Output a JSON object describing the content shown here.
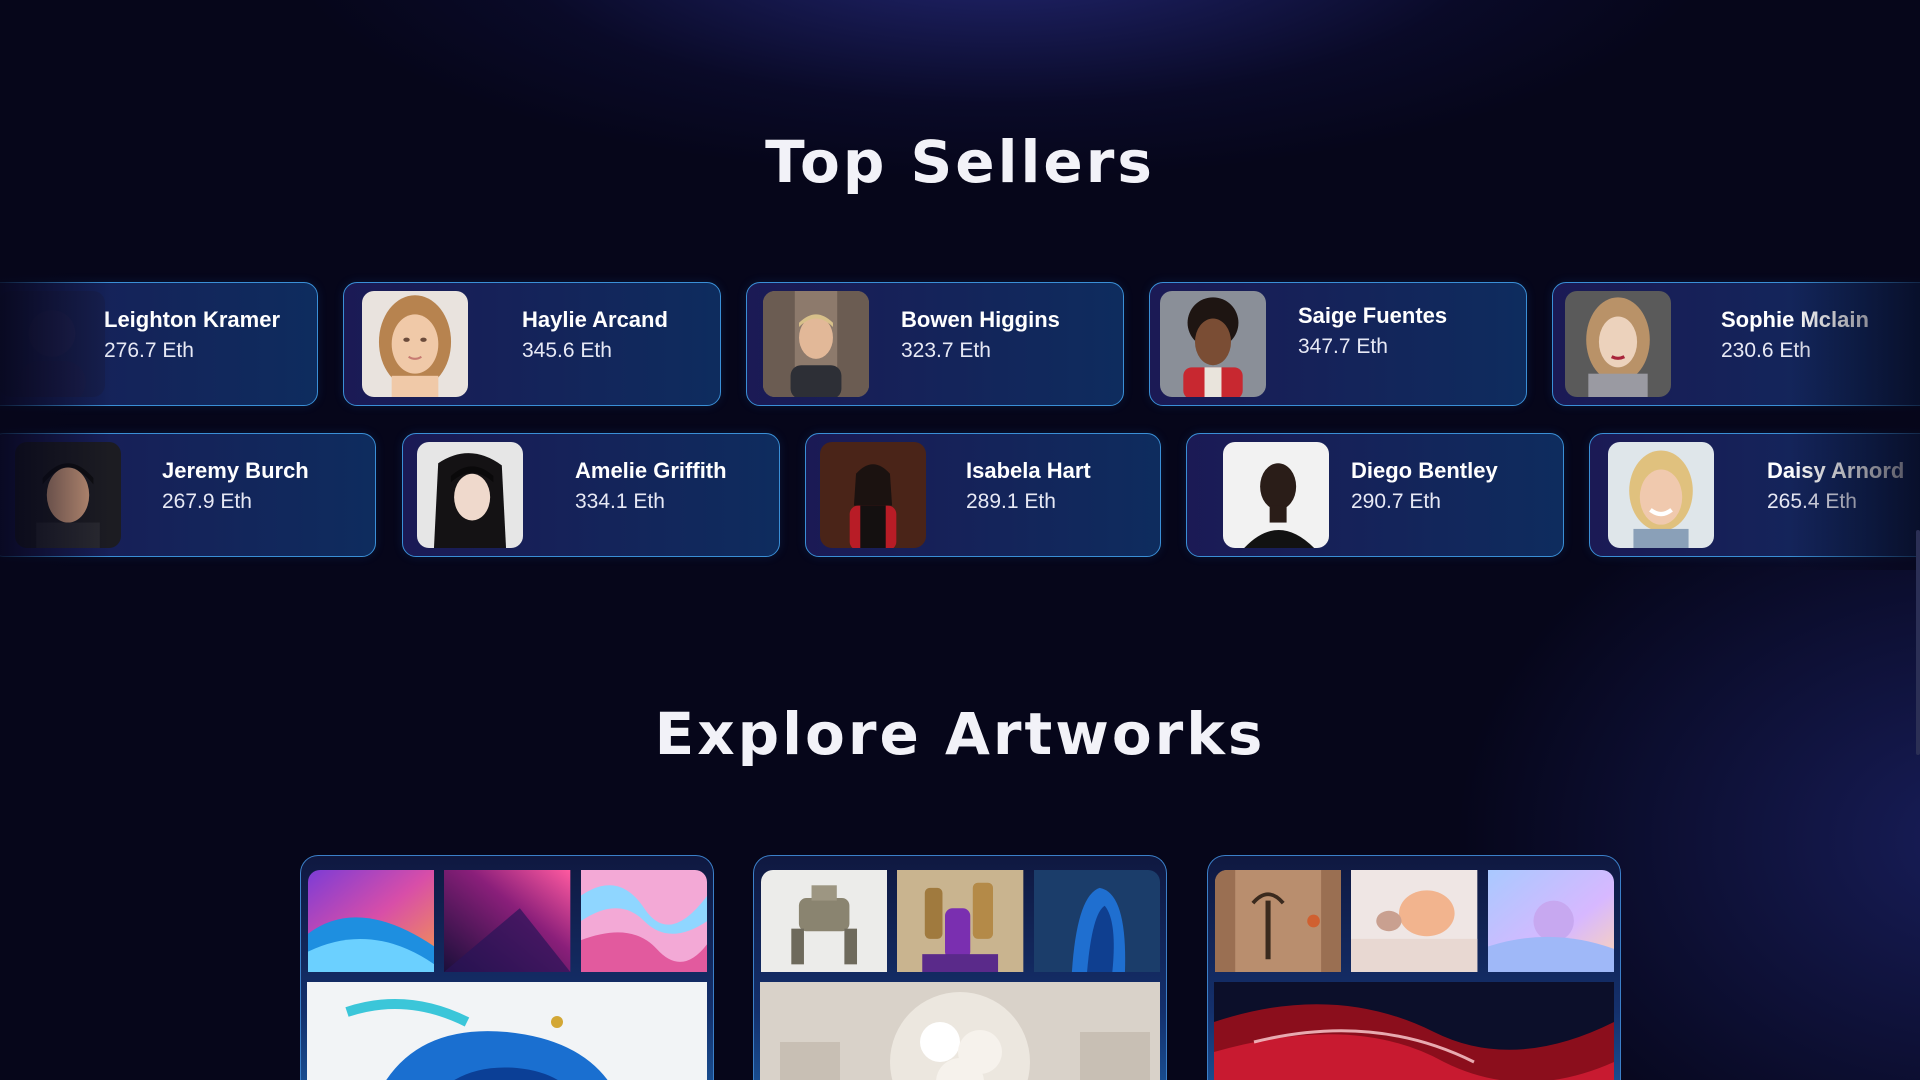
{
  "sections": {
    "top_sellers_title": "Top Sellers",
    "explore_title": "Explore Artworks"
  },
  "sellers_row_1": [
    {
      "name": "Leighton Kramer",
      "amount": "276.7 Eth",
      "avatar": "avatar-leighton"
    },
    {
      "name": "Haylie Arcand",
      "amount": "345.6 Eth",
      "avatar": "avatar-haylie"
    },
    {
      "name": "Bowen Higgins",
      "amount": "323.7 Eth",
      "avatar": "avatar-bowen"
    },
    {
      "name": "Saige Fuentes",
      "amount": "347.7 Eth",
      "avatar": "avatar-saige"
    },
    {
      "name": "Sophie Mclain",
      "amount": "230.6 Eth",
      "avatar": "avatar-sophie"
    }
  ],
  "sellers_row_2": [
    {
      "name": "Jeremy Burch",
      "amount": "267.9 Eth",
      "avatar": "avatar-jeremy"
    },
    {
      "name": "Amelie Griffith",
      "amount": "334.1 Eth",
      "avatar": "avatar-amelie"
    },
    {
      "name": "Isabela Hart",
      "amount": "289.1 Eth",
      "avatar": "avatar-isabela"
    },
    {
      "name": "Diego Bentley",
      "amount": "290.7 Eth",
      "avatar": "avatar-diego"
    },
    {
      "name": "Daisy Arnord",
      "amount": "265.4 Eth",
      "avatar": "avatar-daisy"
    }
  ],
  "artworks": [
    {
      "collection": "abstract-fluid",
      "thumbs": [
        "purple-blue-waves",
        "magenta-galaxy",
        "pink-marble-swirl"
      ],
      "cover": "blue-ink-splash"
    },
    {
      "collection": "3d-sculpture",
      "thumbs": [
        "robot-mech",
        "purple-gold-statue",
        "blue-draped-cloth"
      ],
      "cover": "white-ruffle-sphere"
    },
    {
      "collection": "surreal-render",
      "thumbs": [
        "palm-arch-room",
        "peach-blob-mirror",
        "pastel-sphere"
      ],
      "cover": "red-silk-wave"
    }
  ],
  "colors": {
    "background": "#06061a",
    "card_border": "#3a8fd6",
    "card_fill_start": "#1b1a55",
    "card_fill_end": "#0e2c5e"
  }
}
